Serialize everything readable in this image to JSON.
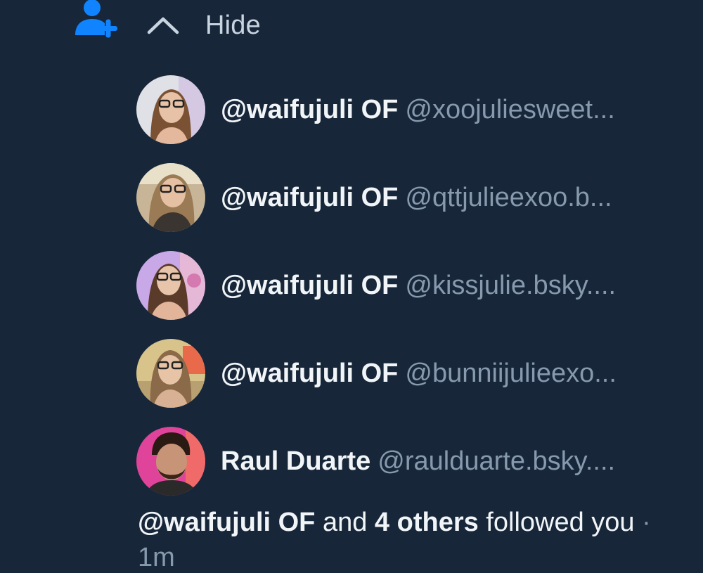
{
  "header": {
    "follow_icon": "person-plus-icon",
    "toggle_icon": "chevron-up-icon",
    "hide_label": "Hide",
    "accent_color": "#1083fe"
  },
  "users": [
    {
      "display_name": "@waifujuli OF",
      "handle": "@xoojuliesweet..."
    },
    {
      "display_name": "@waifujuli OF",
      "handle": "@qttjulieexoo.b..."
    },
    {
      "display_name": "@waifujuli OF",
      "handle": "@kissjulie.bsky...."
    },
    {
      "display_name": "@waifujuli OF",
      "handle": "@bunniijulieexo..."
    },
    {
      "display_name": "Raul Duarte",
      "handle": "@raulduarte.bsky...."
    }
  ],
  "summary": {
    "first_name": "@waifujuli OF",
    "and_text": " and ",
    "others": "4 others",
    "followed_text": " followed you",
    "separator": " · ",
    "time": "1m"
  }
}
